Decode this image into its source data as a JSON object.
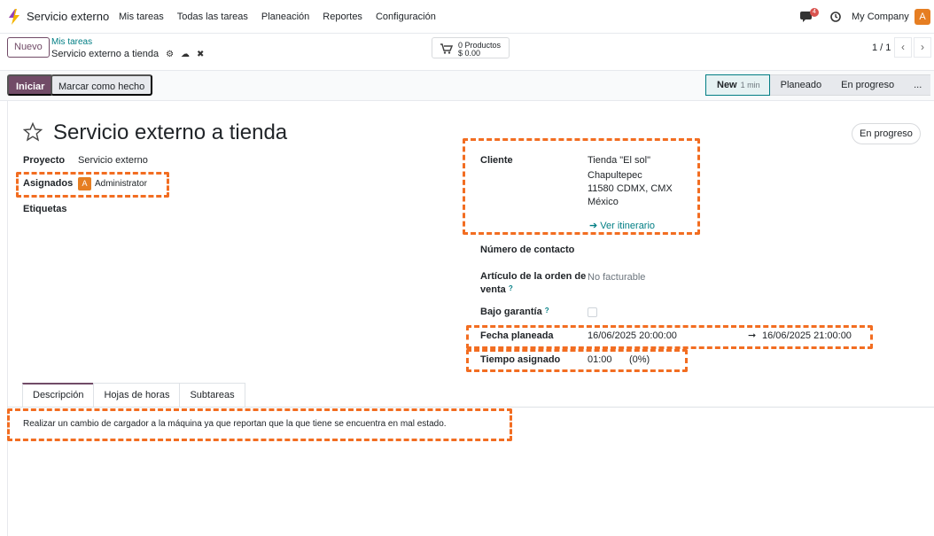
{
  "topnav": {
    "app_name": "Servicio externo",
    "menu": [
      "Mis tareas",
      "Todas las tareas",
      "Planeación",
      "Reportes",
      "Configuración"
    ],
    "chat_badge": "4",
    "company": "My Company",
    "user_initial": "A"
  },
  "control": {
    "new_label": "Nuevo",
    "breadcrumb_parent": "Mis tareas",
    "breadcrumb_current": "Servicio externo a tienda",
    "cart_line1": "0 Productos",
    "cart_line2": "$ 0.00",
    "pager": "1 / 1"
  },
  "statusbar": {
    "start_label": "Iniciar",
    "done_label": "Marcar como hecho",
    "stages": [
      {
        "label": "New",
        "duration": "1 min",
        "active": true
      },
      {
        "label": "Planeado"
      },
      {
        "label": "En progreso"
      },
      {
        "label": "..."
      }
    ]
  },
  "form": {
    "title": "Servicio externo a tienda",
    "state_button": "En progreso",
    "project_label": "Proyecto",
    "project_value": "Servicio externo",
    "assigned_label": "Asignados",
    "assigned_initial": "A",
    "assigned_value": "Administrator",
    "tags_label": "Etiquetas",
    "client_label": "Cliente",
    "client_lines": [
      "Tienda \"El sol\"",
      "Chapultepec",
      "11580 CDMX, CMX",
      "México"
    ],
    "itinerary_link": "Ver itinerario",
    "contact_label": "Número de contacto",
    "so_item_label_1": "Artículo de la orden de",
    "so_item_label_2": "venta",
    "so_item_value": "No facturable",
    "warranty_label": "Bajo garantía",
    "planned_label": "Fecha planeada",
    "planned_start": "16/06/2025 20:00:00",
    "planned_end": "16/06/2025 21:00:00",
    "allocated_label": "Tiempo asignado",
    "allocated_value": "01:00",
    "allocated_pct": "(0%)"
  },
  "tabs": [
    "Descripción",
    "Hojas de horas",
    "Subtareas"
  ],
  "description": "Realizar un cambio de cargador a la máquina ya que reportan que la que tiene se encuentra en mal estado.",
  "colors": {
    "brand": "#714b67",
    "link": "#017e84",
    "highlight": "#f26d21"
  }
}
